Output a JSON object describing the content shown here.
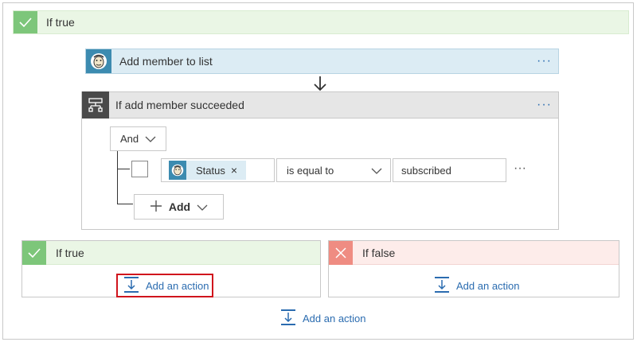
{
  "outer": {
    "label": "If true"
  },
  "action": {
    "title": "Add member to list",
    "menu": "···"
  },
  "condition": {
    "title": "If add member succeeded",
    "menu": "···",
    "group_operator": "And",
    "row": {
      "token": "Status",
      "token_remove": "×",
      "operator": "is equal to",
      "value": "subscribed",
      "more": "···"
    },
    "add_label": "Add"
  },
  "branches": {
    "true": {
      "label": "If true",
      "add_action": "Add an action"
    },
    "false": {
      "label": "If false",
      "add_action": "Add an action"
    }
  },
  "footer": {
    "add_action": "Add an action"
  },
  "colors": {
    "success_green": "#7dc67a",
    "fail_red": "#ef8c82",
    "link_blue": "#2b6cb0",
    "highlight_red": "#d0151d"
  }
}
